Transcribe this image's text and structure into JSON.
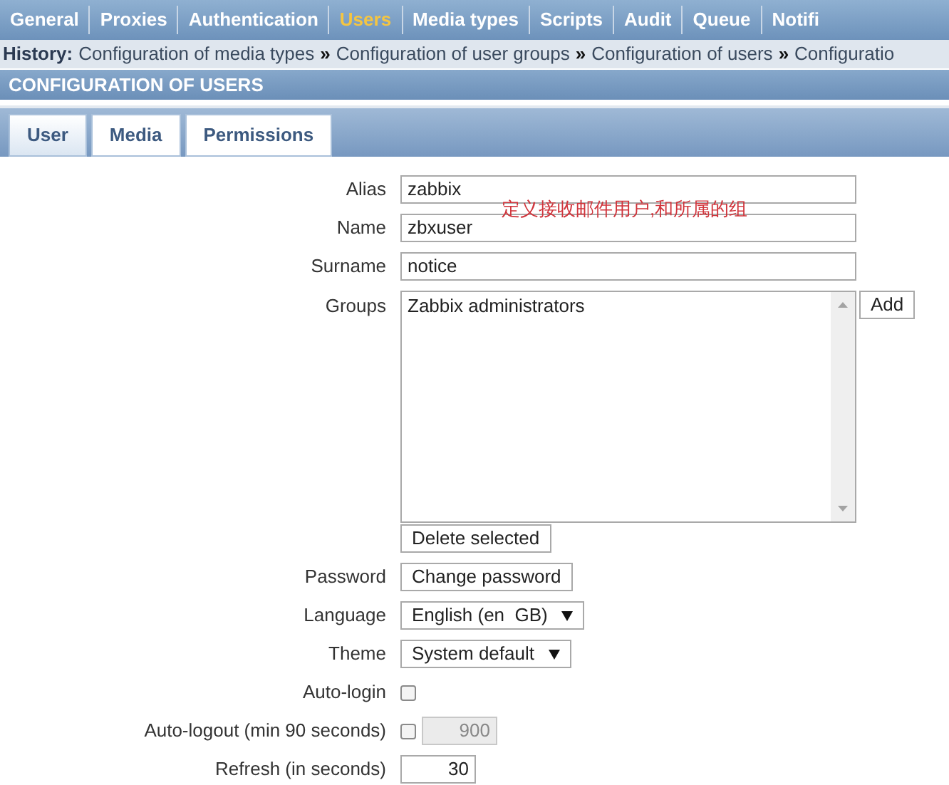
{
  "nav": [
    {
      "label": "General",
      "selected": false
    },
    {
      "label": "Proxies",
      "selected": false
    },
    {
      "label": "Authentication",
      "selected": false
    },
    {
      "label": "Users",
      "selected": true
    },
    {
      "label": "Media types",
      "selected": false
    },
    {
      "label": "Scripts",
      "selected": false
    },
    {
      "label": "Audit",
      "selected": false
    },
    {
      "label": "Queue",
      "selected": false
    },
    {
      "label": "Notifi",
      "selected": false
    }
  ],
  "history": {
    "label": "History:",
    "separator": "»",
    "items": [
      "Configuration of media types",
      "Configuration of user groups",
      "Configuration of users",
      "Configuratio"
    ]
  },
  "section_title": "CONFIGURATION OF USERS",
  "tabs": [
    {
      "label": "User",
      "selected": true
    },
    {
      "label": "Media",
      "selected": false
    },
    {
      "label": "Permissions",
      "selected": false
    }
  ],
  "annotation": "定义接收邮件用户,和所属的组",
  "form": [
    {
      "kind": "text",
      "label": "Alias",
      "value": "zabbix"
    },
    {
      "kind": "text",
      "label": "Name",
      "value": "zbxuser"
    },
    {
      "kind": "text",
      "label": "Surname",
      "value": "notice"
    },
    {
      "kind": "groups",
      "label": "Groups",
      "items": [
        "Zabbix administrators"
      ],
      "add_button": "Add",
      "delete_button": "Delete selected"
    },
    {
      "kind": "button",
      "label": "Password",
      "button": "Change password"
    },
    {
      "kind": "select",
      "label": "Language",
      "value": "English (en  GB)"
    },
    {
      "kind": "select",
      "label": "Theme",
      "value": "System default"
    },
    {
      "kind": "checkbox",
      "label": "Auto-login",
      "checked": false
    },
    {
      "kind": "checkbox_number",
      "label": "Auto-logout (min 90 seconds)",
      "checked": false,
      "value": "900",
      "disabled": true
    },
    {
      "kind": "number",
      "label": "Refresh (in seconds)",
      "value": "30"
    }
  ]
}
